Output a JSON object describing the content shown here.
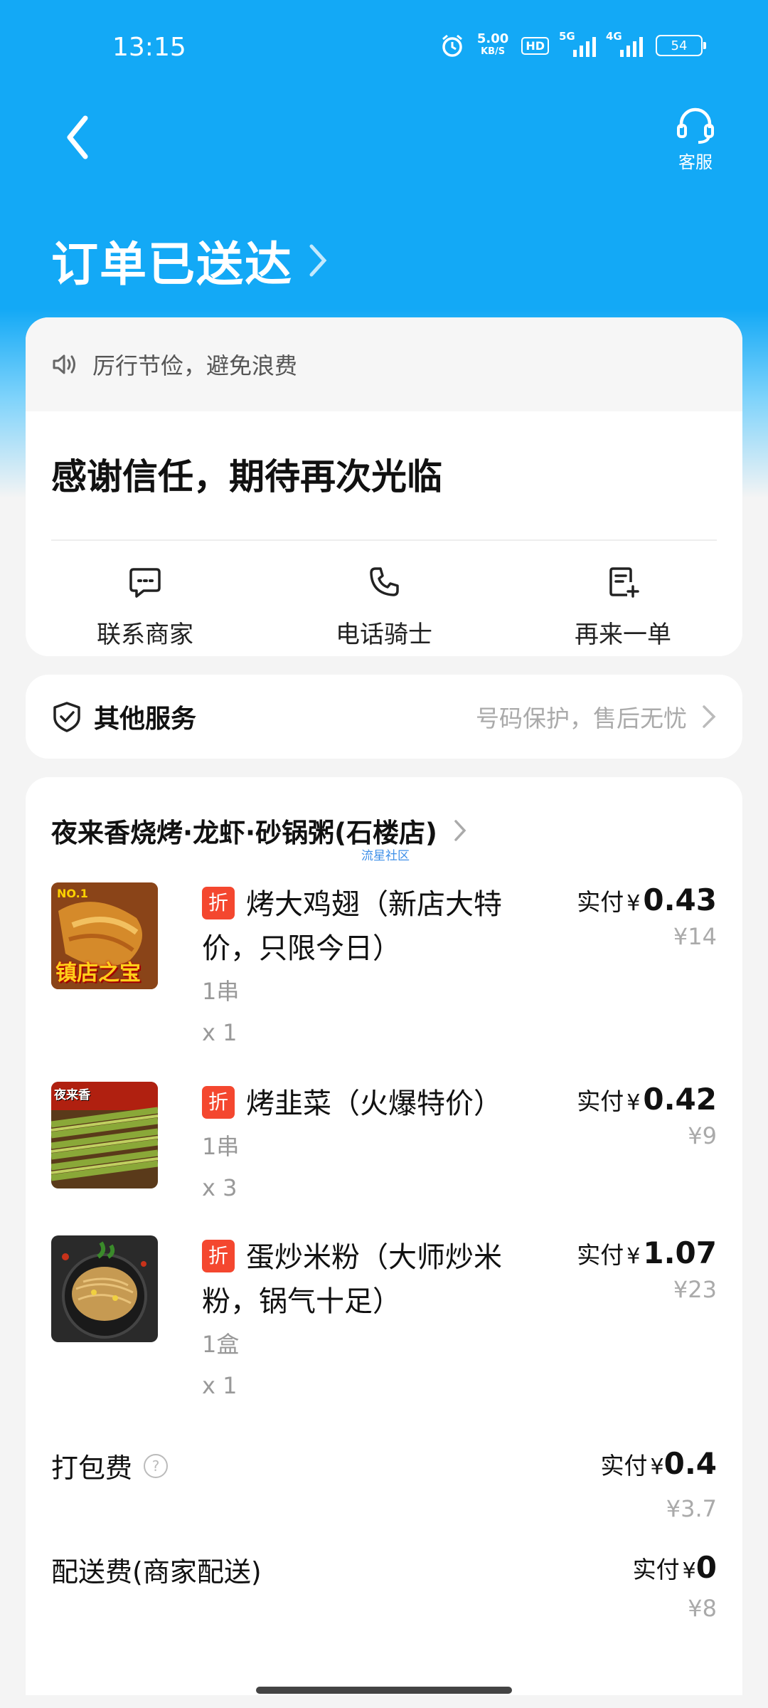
{
  "status_bar": {
    "time": "13:15",
    "net_speed_value": "5.00",
    "net_speed_unit": "KB/S",
    "hd_label": "HD",
    "sim1_label": "5G",
    "sim2_label": "4G",
    "battery": "54"
  },
  "header": {
    "customer_service_label": "客服",
    "order_status": "订单已送达"
  },
  "notice": {
    "text": "厉行节俭，避免浪费"
  },
  "thanks_message": "感谢信任，期待再次光临",
  "actions": [
    {
      "label": "联系商家",
      "icon": "message-icon"
    },
    {
      "label": "电话骑士",
      "icon": "phone-icon"
    },
    {
      "label": "再来一单",
      "icon": "reorder-icon"
    }
  ],
  "other_services": {
    "title": "其他服务",
    "desc": "号码保护，售后无忧"
  },
  "shop": {
    "name": "夜来香烧烤·龙虾·砂锅粥(石楼店)",
    "watermark": "流星社区"
  },
  "items": [
    {
      "badge": "折",
      "name": "烤大鸡翅（新店大特价，只限今日）",
      "spec": "1串",
      "qty": "x 1",
      "paid_label": "实付",
      "currency": "¥",
      "paid": "0.43",
      "original": "¥14",
      "thumb_text": "镇店之宝",
      "thumb_tag": "NO.1"
    },
    {
      "badge": "折",
      "name": "烤韭菜（火爆特价）",
      "spec": "1串",
      "qty": "x 3",
      "paid_label": "实付",
      "currency": "¥",
      "paid": "0.42",
      "original": "¥9",
      "thumb_text": "夜来香"
    },
    {
      "badge": "折",
      "name": "蛋炒米粉（大师炒米粉，锅气十足）",
      "spec": "1盒",
      "qty": "x 1",
      "paid_label": "实付",
      "currency": "¥",
      "paid": "1.07",
      "original": "¥23"
    }
  ],
  "fees": [
    {
      "name": "打包费",
      "help_icon": "?",
      "paid_label": "实付",
      "currency": "¥",
      "paid": "0.4",
      "original": "¥3.7"
    },
    {
      "name": "配送费(商家配送)",
      "paid_label": "实付",
      "currency": "¥",
      "paid": "0",
      "original": "¥8"
    }
  ],
  "colors": {
    "brand_blue": "#13a9f6",
    "discount_red": "#f4472f"
  }
}
